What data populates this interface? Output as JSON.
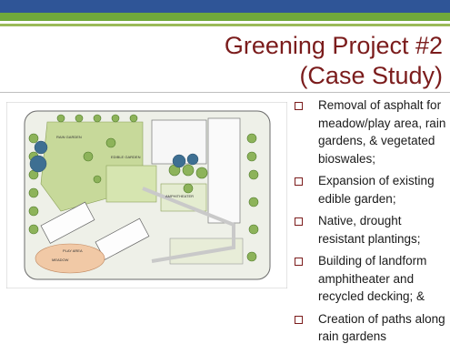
{
  "slide": {
    "title_line1": "Greening Project #2",
    "title_line2": "(Case Study)",
    "title_color": "#7b1c1c",
    "bullets": [
      "Removal of asphalt for meadow/play area, rain gardens, & vegetated bioswales;",
      "Expansion of existing edible garden;",
      "Native, drought resistant plantings;",
      "Building of landform amphitheater and recycled decking; &",
      "Creation of paths along rain gardens"
    ]
  },
  "plan": {
    "label_1": "RAIN GARDEN",
    "label_2": "EDIBLE GARDEN",
    "label_3": "MEADOW",
    "label_4": "PLAY AREA",
    "label_5": "AMPHITHEATER"
  }
}
